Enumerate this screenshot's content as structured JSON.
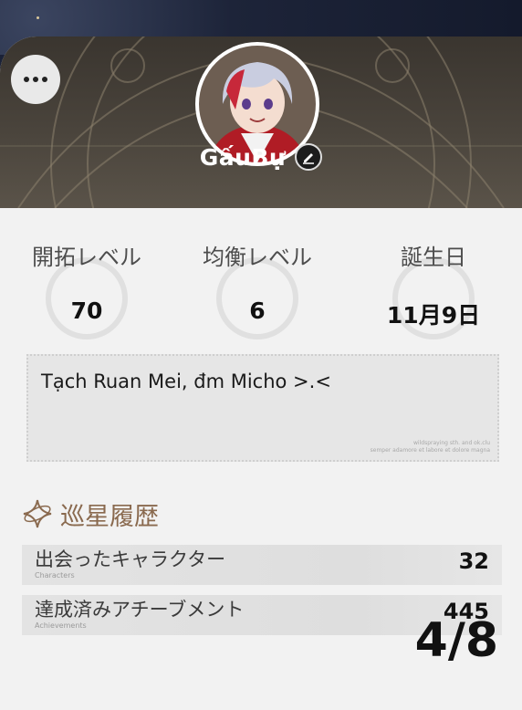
{
  "profile": {
    "nickname": "GấuBự",
    "signature": "Tạch Ruan Mei, đm Micho >.<",
    "signature_decoration": [
      "wildspraying sth. and ok.clu",
      "semper adamore et labore et dolore magna"
    ]
  },
  "stats": [
    {
      "label": "開拓レベル",
      "value": "70"
    },
    {
      "label": "均衡レベル",
      "value": "6"
    },
    {
      "label": "誕生日",
      "value": "11月9日"
    }
  ],
  "records_section": {
    "title": "巡星履歴",
    "items": [
      {
        "label": "出会ったキャラクター",
        "sublabel": "Characters",
        "value": "32"
      },
      {
        "label": "達成済みアチーブメント",
        "sublabel": "Achievements",
        "value": "445"
      }
    ]
  },
  "page_counter": "4/8",
  "icons": {
    "menu": "more-dots-icon",
    "edit": "pencil-icon",
    "section": "sparkle-star-icon"
  },
  "colors": {
    "header": "#3a352f",
    "section_title": "#8a6a4f",
    "card": "#f2f2f2"
  }
}
